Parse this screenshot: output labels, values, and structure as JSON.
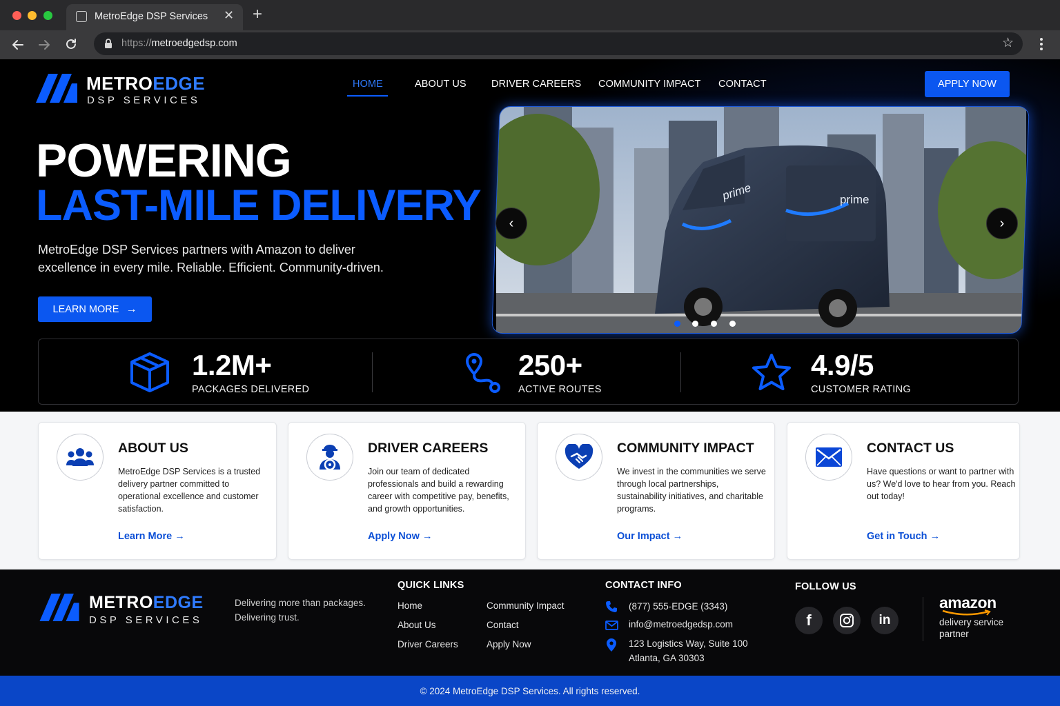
{
  "browser": {
    "tab_title": "MetroEdge DSP Services",
    "url_scheme": "https://",
    "url_host": "metroedgedsp.com"
  },
  "brand": {
    "name_part1": "METRO",
    "name_part2": "EDGE",
    "sub": "DSP SERVICES",
    "accent": "#0b5cff"
  },
  "nav": {
    "items": [
      {
        "label": "HOME"
      },
      {
        "label": "ABOUT US"
      },
      {
        "label": "DRIVER CAREERS"
      },
      {
        "label": "COMMUNITY IMPACT"
      },
      {
        "label": "CONTACT"
      }
    ],
    "active": "HOME",
    "apply": "APPLY NOW"
  },
  "hero": {
    "line1": "POWERING",
    "line2": "LAST-MILE DELIVERY",
    "paragraph": "MetroEdge DSP Services partners with Amazon to deliver excellence in every mile. Reliable. Efficient. Community-driven.",
    "cta": "LEARN MORE",
    "van_brand_1": "prime",
    "van_brand_2": "prime",
    "carousel_active_index": 1,
    "carousel_count": 4
  },
  "stats": [
    {
      "icon": "package-icon",
      "value": "1.2M+",
      "label": "PACKAGES DELIVERED"
    },
    {
      "icon": "route-icon",
      "value": "250+",
      "label": "ACTIVE ROUTES"
    },
    {
      "icon": "star-icon",
      "value": "4.9/5",
      "label": "CUSTOMER RATING"
    }
  ],
  "cards": [
    {
      "icon": "team-icon",
      "title": "ABOUT US",
      "body": "MetroEdge DSP Services is a trusted delivery partner committed to operational excellence and customer satisfaction.",
      "link": "Learn More"
    },
    {
      "icon": "driver-icon",
      "title": "DRIVER CAREERS",
      "body": "Join our team of dedicated professionals and build a rewarding career with competitive pay, benefits, and growth opportunities.",
      "link": "Apply Now"
    },
    {
      "icon": "heart-handshake-icon",
      "title": "COMMUNITY IMPACT",
      "body": "We invest in the communities we serve through local partnerships, sustainability initiatives, and charitable programs.",
      "link": "Our Impact"
    },
    {
      "icon": "envelope-icon",
      "title": "CONTACT US",
      "body": "Have questions or want to partner with us? We'd love to hear from you. Reach out today!",
      "link": "Get in Touch"
    }
  ],
  "footer": {
    "tagline_1": "Delivering more than packages.",
    "tagline_2": "Delivering trust.",
    "quick_links_title": "QUICK LINKS",
    "quick_links_col1": [
      "Home",
      "About Us",
      "Driver Careers"
    ],
    "quick_links_col2": [
      "Community Impact",
      "Contact",
      "Apply Now"
    ],
    "contact_title": "CONTACT INFO",
    "phone": "(877) 555-EDGE (3343)",
    "email": "info@metroedgedsp.com",
    "address_1": "123 Logistics Way, Suite 100",
    "address_2": "Atlanta, GA 30303",
    "follow_title": "FOLLOW US",
    "partner_brand": "amazon",
    "partner_line1": "delivery service",
    "partner_line2": "partner",
    "copyright": "© 2024 MetroEdge DSP Services. All rights reserved."
  }
}
